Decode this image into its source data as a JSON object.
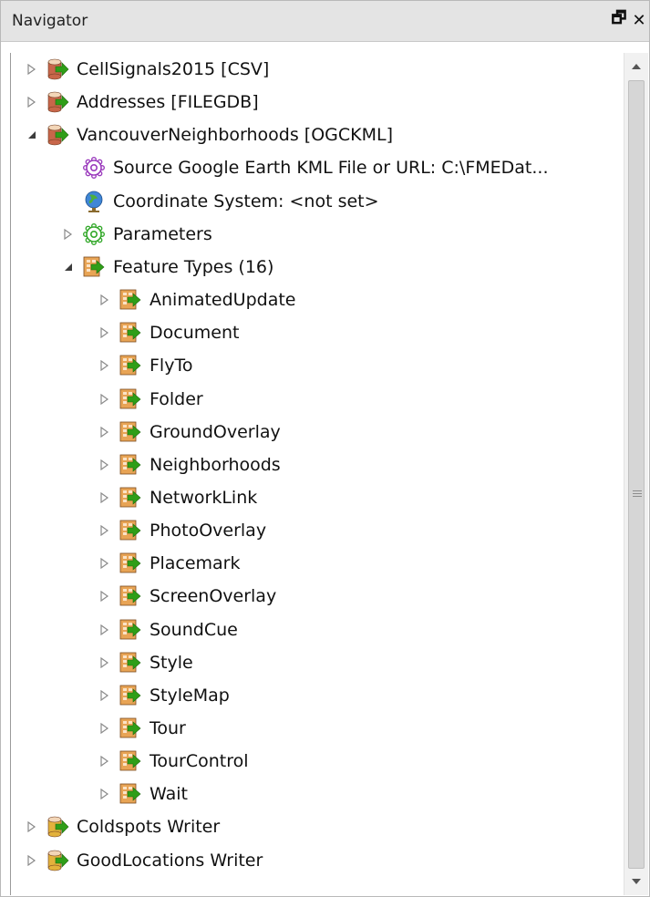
{
  "panel": {
    "title": "Navigator",
    "float_glyph": "🗗",
    "close_glyph": "✕"
  },
  "colors": {
    "titlebar_bg": "#e4e4e4",
    "reader_db": "#c8664a",
    "writer_db": "#e3b23c",
    "arrow_green": "#2f9e18",
    "gear_purple": "#9b3bbd",
    "gear_green": "#33a82a",
    "feature_tile": "#e8a455"
  },
  "tree": {
    "items": [
      {
        "label": "CellSignals2015 [CSV]",
        "level": 0,
        "expander": "collapsed",
        "icon": "reader-database-icon"
      },
      {
        "label": "Addresses [FILEGDB]",
        "level": 0,
        "expander": "collapsed",
        "icon": "reader-database-icon"
      },
      {
        "label": "VancouverNeighborhoods [OGCKML]",
        "level": 0,
        "expander": "expanded",
        "icon": "reader-database-icon"
      },
      {
        "label": "Source Google Earth KML File or URL: C:\\FMEDat...",
        "level": 1,
        "expander": "none",
        "icon": "gear-purple-icon"
      },
      {
        "label": "Coordinate System: <not set>",
        "level": 1,
        "expander": "none",
        "icon": "globe-icon"
      },
      {
        "label": "Parameters",
        "level": 1,
        "expander": "collapsed",
        "icon": "gear-green-icon"
      },
      {
        "label": "Feature Types (16)",
        "level": 1,
        "expander": "expanded",
        "icon": "feature-types-icon"
      },
      {
        "label": "AnimatedUpdate",
        "level": 2,
        "expander": "collapsed",
        "icon": "feature-type-icon"
      },
      {
        "label": "Document",
        "level": 2,
        "expander": "collapsed",
        "icon": "feature-type-icon"
      },
      {
        "label": "FlyTo",
        "level": 2,
        "expander": "collapsed",
        "icon": "feature-type-icon"
      },
      {
        "label": "Folder",
        "level": 2,
        "expander": "collapsed",
        "icon": "feature-type-icon"
      },
      {
        "label": "GroundOverlay",
        "level": 2,
        "expander": "collapsed",
        "icon": "feature-type-icon"
      },
      {
        "label": "Neighborhoods",
        "level": 2,
        "expander": "collapsed",
        "icon": "feature-type-icon"
      },
      {
        "label": "NetworkLink",
        "level": 2,
        "expander": "collapsed",
        "icon": "feature-type-icon"
      },
      {
        "label": "PhotoOverlay",
        "level": 2,
        "expander": "collapsed",
        "icon": "feature-type-icon"
      },
      {
        "label": "Placemark",
        "level": 2,
        "expander": "collapsed",
        "icon": "feature-type-icon"
      },
      {
        "label": "ScreenOverlay",
        "level": 2,
        "expander": "collapsed",
        "icon": "feature-type-icon"
      },
      {
        "label": "SoundCue",
        "level": 2,
        "expander": "collapsed",
        "icon": "feature-type-icon"
      },
      {
        "label": "Style",
        "level": 2,
        "expander": "collapsed",
        "icon": "feature-type-icon"
      },
      {
        "label": "StyleMap",
        "level": 2,
        "expander": "collapsed",
        "icon": "feature-type-icon"
      },
      {
        "label": "Tour",
        "level": 2,
        "expander": "collapsed",
        "icon": "feature-type-icon"
      },
      {
        "label": "TourControl",
        "level": 2,
        "expander": "collapsed",
        "icon": "feature-type-icon"
      },
      {
        "label": "Wait",
        "level": 2,
        "expander": "collapsed",
        "icon": "feature-type-icon"
      },
      {
        "label": "Coldspots Writer",
        "level": 0,
        "expander": "collapsed",
        "icon": "writer-database-icon"
      },
      {
        "label": "GoodLocations Writer",
        "level": 0,
        "expander": "collapsed",
        "icon": "writer-database-icon"
      }
    ]
  }
}
